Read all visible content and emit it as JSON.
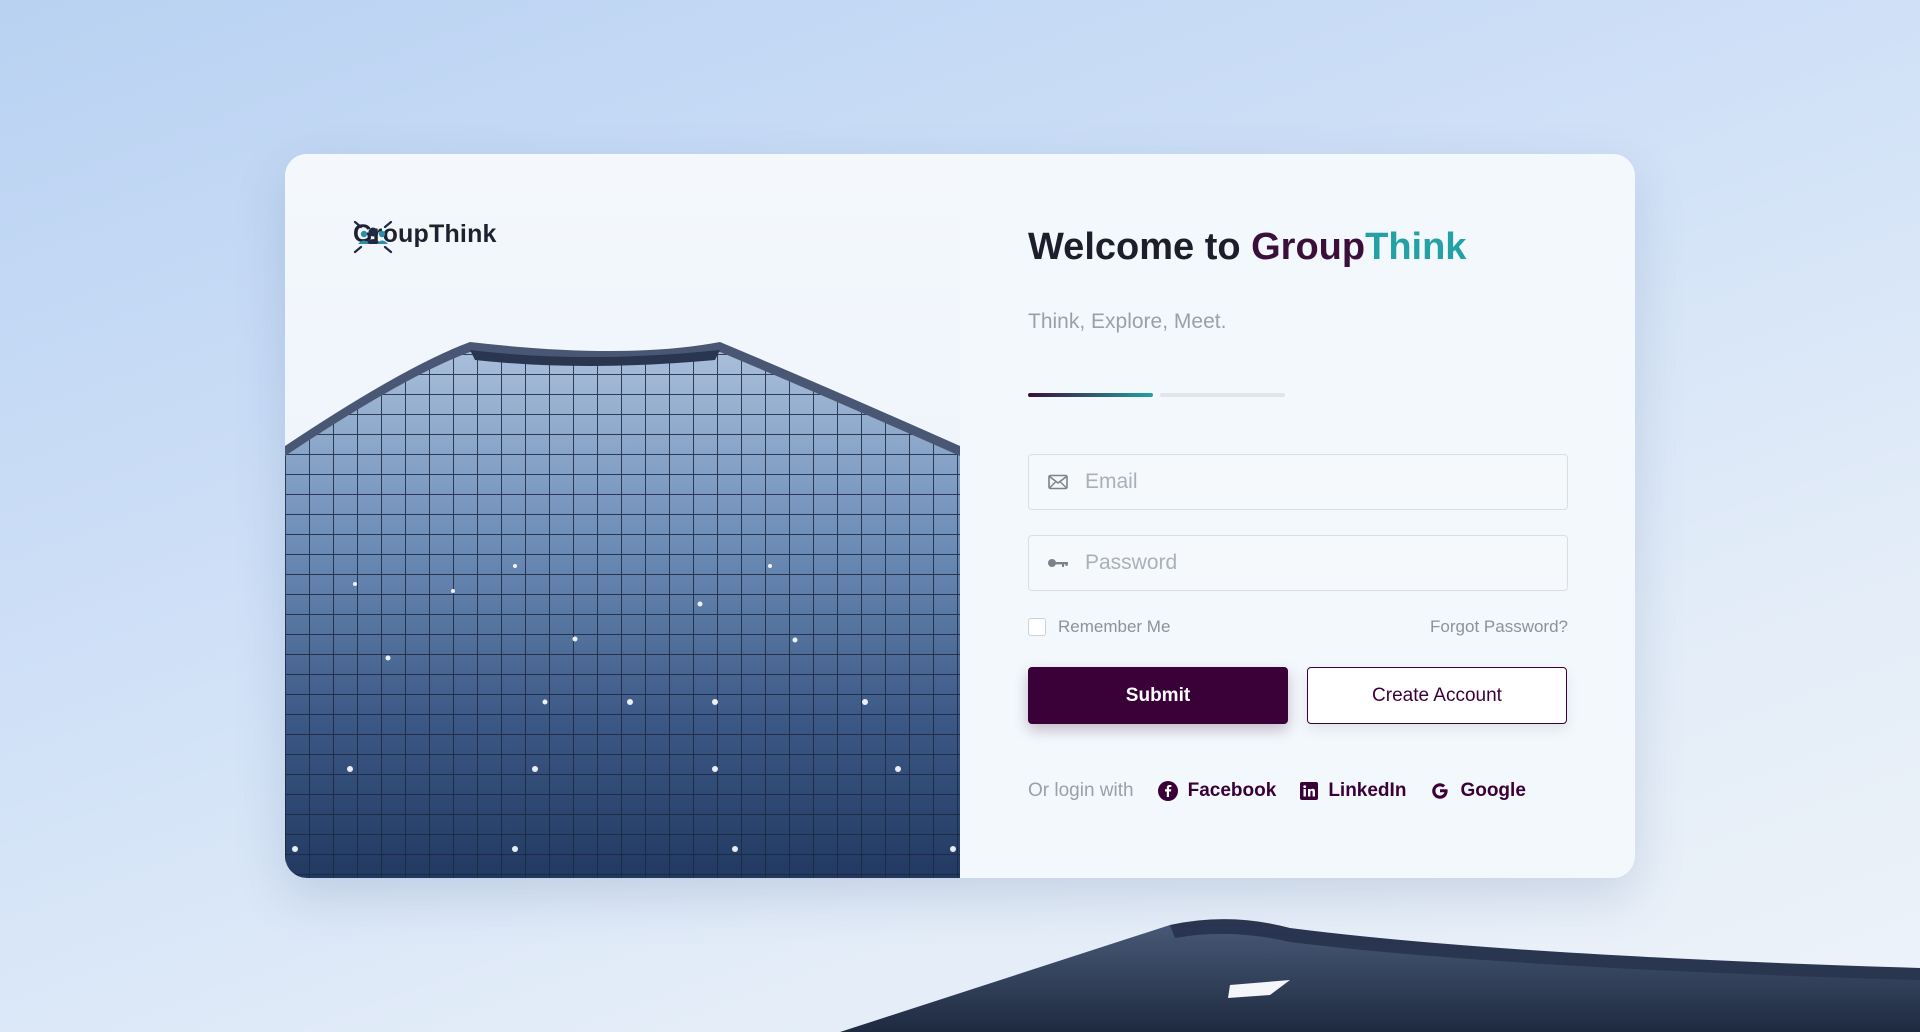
{
  "brand": {
    "name": "GroupThink"
  },
  "heading": {
    "prefix": "Welcome to ",
    "brand_part1": "Group",
    "brand_part2": "Think"
  },
  "tagline": "Think, Explore, Meet.",
  "form": {
    "email_placeholder": "Email",
    "password_placeholder": "Password",
    "remember_label": "Remember Me",
    "forgot_label": "Forgot Password?",
    "submit_label": "Submit",
    "create_label": "Create Account"
  },
  "social": {
    "label": "Or login with",
    "providers": [
      {
        "name": "Facebook",
        "icon": "facebook-icon"
      },
      {
        "name": "LinkedIn",
        "icon": "linkedin-icon"
      },
      {
        "name": "Google",
        "icon": "google-icon"
      }
    ]
  },
  "progress": {
    "steps": 2,
    "current": 1
  },
  "colors": {
    "primary": "#3a0038",
    "accent": "#23a1a4",
    "background": "#cfe0f7"
  }
}
